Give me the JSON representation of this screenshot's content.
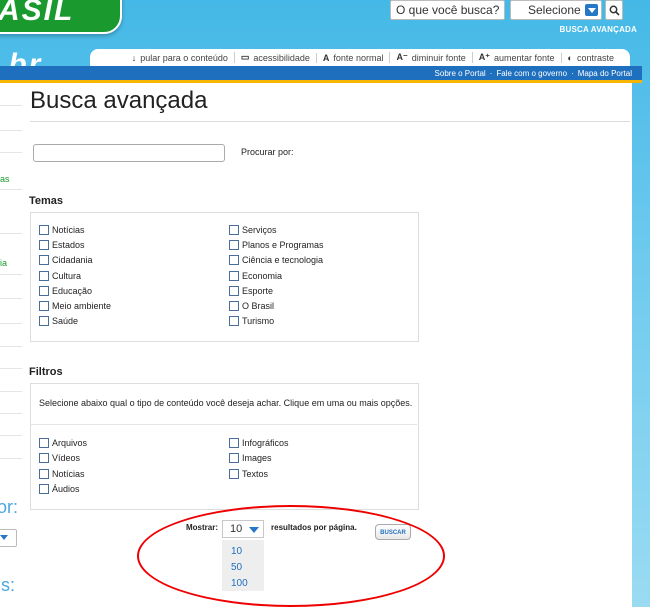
{
  "header": {
    "logo_text": "ASIL .br",
    "search_placeholder": "O que você busca?",
    "select_label": "Selecione",
    "advanced_search_link": "BUSCA AVANÇADA"
  },
  "accessibility_bar": {
    "items": [
      {
        "icon": "↓",
        "label": "pular para o conteúdo"
      },
      {
        "icon": "▭",
        "label": "acessibilidade"
      },
      {
        "icon": "A",
        "label": "fonte normal"
      },
      {
        "icon": "A⁻",
        "label": "diminuir fonte"
      },
      {
        "icon": "A⁺",
        "label": "aumentar fonte"
      },
      {
        "icon": "◐",
        "label": "contraste"
      }
    ]
  },
  "gov_bar": {
    "links": [
      "Sobre o Portal",
      "Fale com o governo",
      "Mapa do Portal"
    ]
  },
  "left_nav": {
    "item1": "as",
    "item2": "ia",
    "item3": "or:",
    "item4": "is:"
  },
  "page": {
    "title": "Busca avançada",
    "search_label": "Procurar por:"
  },
  "temas": {
    "heading": "Temas",
    "left": [
      "Notícias",
      "Estados",
      "Cidadania",
      "Cultura",
      "Educação",
      "Meio ambiente",
      "Saúde"
    ],
    "right": [
      "Serviços",
      "Planos e Programas",
      "Ciência e tecnologia",
      "Economia",
      "Esporte",
      "O Brasil",
      "Turismo"
    ]
  },
  "filtros": {
    "heading": "Filtros",
    "intro": "Selecione abaixo qual o tipo de conteúdo você deseja achar. Clique em uma ou mais opções.",
    "left": [
      "Arquivos",
      "Vídeos",
      "Notícias",
      "Áudios"
    ],
    "right": [
      "Infográficos",
      "Images",
      "Textos"
    ]
  },
  "results": {
    "mostrar_label": "Mostrar:",
    "selected": "10",
    "per_page_label": "resultados por página.",
    "buscar_label": "BUSCAR",
    "options": [
      "10",
      "50",
      "100"
    ]
  },
  "colors": {
    "accent_blue": "#1f6fbf",
    "brand_green": "#1a9a2e",
    "annotation_red": "#e00000"
  }
}
